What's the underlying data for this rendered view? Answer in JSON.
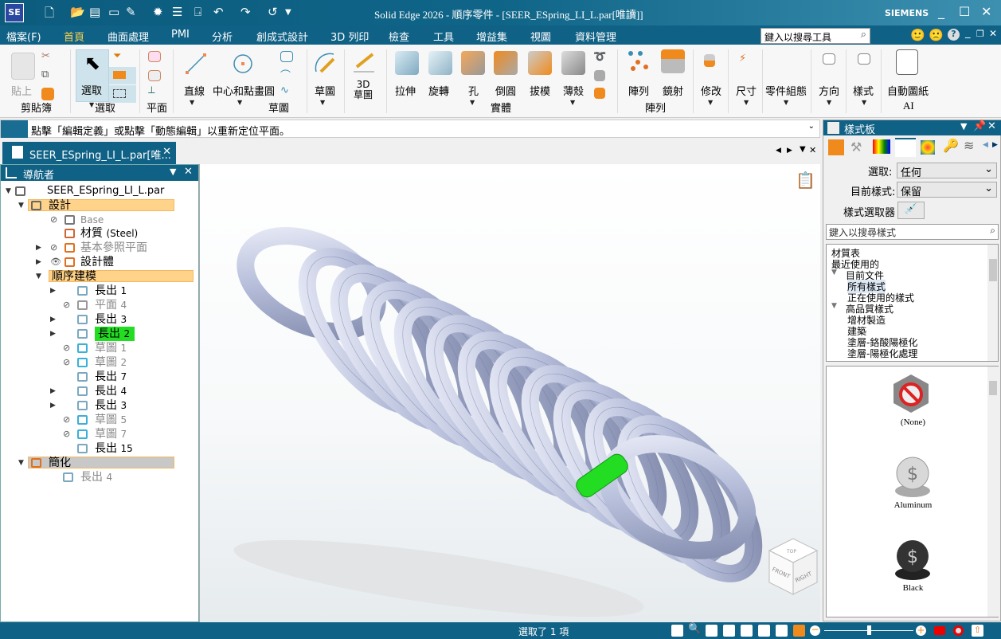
{
  "app": {
    "logo": "SE",
    "title": "Solid Edge 2026 - 順序零件 - [SEER_ESpring_LI_L.par[唯讀]]",
    "brand": "SIEMENS"
  },
  "menu": {
    "items": [
      "檔案(F)",
      "首頁",
      "曲面處理",
      "PMI",
      "分析",
      "創成式設計",
      "3D 列印",
      "檢查",
      "工具",
      "增益集",
      "視圖",
      "資料管理"
    ],
    "active": "首頁",
    "search_placeholder": "鍵入以搜尋工具"
  },
  "ribbon": {
    "buttons": {
      "paste": "貼上",
      "select": "選取",
      "line": "直線",
      "circle": "中心和點畫圓",
      "sketch": "草圖",
      "sketch3d": "3D\n草圖",
      "extrude": "拉伸",
      "revolve": "旋轉",
      "hole": "孔",
      "round": "倒圓",
      "draft": "拔模",
      "thin": "薄殼",
      "pattern": "陣列",
      "mirror": "鏡射",
      "modify": "修改",
      "dimension": "尺寸",
      "config": "零件組態",
      "orient": "方向",
      "style": "樣式",
      "autodraw": "自動圖紙"
    },
    "groups": {
      "clipboard": "剪貼簿",
      "select": "選取",
      "plane": "平面",
      "sketch": "草圖",
      "solids": "實體",
      "pattern": "陣列",
      "ai": "AI"
    }
  },
  "prompt": "點擊「編輯定義」或點擊「動態編輯」以重新定位平面。",
  "doc_tab": "SEER_ESpring_LI_L.par[唯...",
  "navigator": {
    "title": "導航者",
    "root": "SEER_ESpring_LI_L.par",
    "design": "設計",
    "base": "Base",
    "material": "材質",
    "material_value": "(Steel)",
    "ref_planes": "基本參照平面",
    "design_body": "設計體",
    "ordered": "順序建模",
    "features": [
      {
        "name": "長出",
        "num": "1",
        "dim": false
      },
      {
        "name": "平面",
        "num": "4",
        "dim": true
      },
      {
        "name": "長出",
        "num": "3",
        "dim": false
      },
      {
        "name": "長出",
        "num": "2",
        "dim": false,
        "selected": true
      },
      {
        "name": "草圖",
        "num": "1",
        "dim": true
      },
      {
        "name": "草圖",
        "num": "2",
        "dim": true
      },
      {
        "name": "長出",
        "num": "7",
        "dim": false
      },
      {
        "name": "長出",
        "num": "4",
        "dim": false
      },
      {
        "name": "長出",
        "num": "3",
        "dim": false
      },
      {
        "name": "草圖",
        "num": "5",
        "dim": true
      },
      {
        "name": "草圖",
        "num": "7",
        "dim": true
      },
      {
        "name": "長出",
        "num": "15",
        "dim": false
      }
    ],
    "simplify": "簡化",
    "simplify_child": {
      "name": "長出",
      "num": "4"
    }
  },
  "viewcube": {
    "top": "TOP",
    "front": "FRONT",
    "right": "RIGHT"
  },
  "style_panel": {
    "title": "樣式板",
    "select_label": "選取:",
    "select_value": "任何",
    "current_label": "目前樣式:",
    "current_value": "保留",
    "picker_label": "樣式選取器",
    "search_placeholder": "鍵入以搜尋樣式",
    "tree": [
      "材質表",
      "最近使用的",
      "目前文件",
      "所有樣式",
      "正在使用的樣式",
      "高品質樣式",
      "增材製造",
      "建築",
      "塗層-鉻酸陽極化",
      "塗層-陽極化處理"
    ],
    "swatches": [
      "(None)",
      "Aluminum",
      "Black"
    ]
  },
  "status": {
    "text": "選取了 1 項",
    "zoom_slider": 0.5
  },
  "colors": {
    "accent": "#0f6185",
    "selection": "#22dd22",
    "highlight": "#ffd38a"
  }
}
